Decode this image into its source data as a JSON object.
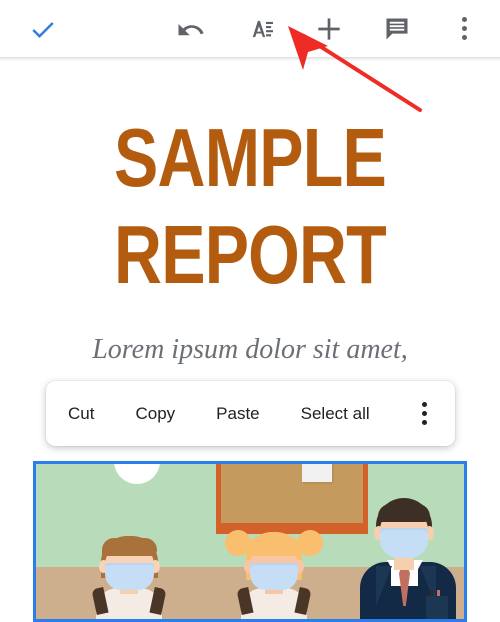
{
  "app": {
    "name": "Google Docs mobile editor",
    "accent_blue": "#2b7de9",
    "icon_gray": "#5f6368",
    "title_color": "#b35c0f",
    "subtitle_color": "#6b7076"
  },
  "toolbar": {
    "accept_label": "✓",
    "accept_name": "accept-checkmark",
    "items": [
      {
        "name": "accept-button",
        "icon": "checkmark-icon",
        "label": "Accept"
      },
      {
        "name": "undo-button",
        "icon": "undo-icon",
        "label": "Undo"
      },
      {
        "name": "format-button",
        "icon": "text-format-icon",
        "label": "Format"
      },
      {
        "name": "insert-button",
        "icon": "plus-icon",
        "label": "Insert"
      },
      {
        "name": "comment-button",
        "icon": "comment-bubble-icon",
        "label": "Comment"
      },
      {
        "name": "overflow-button",
        "icon": "three-dots-vertical-icon",
        "label": "More options"
      }
    ]
  },
  "document": {
    "title": "SAMPLE\nREPORT",
    "subtitle": "Lorem ipsum dolor sit amet,",
    "image": {
      "alt": "Classroom illustration with two masked children and a masked teacher",
      "selected": true,
      "selection_color": "#2b7de9",
      "wall_color": "#b8dcb9",
      "floor_color": "#ceaf8d",
      "board_frame_color": "#d2612a",
      "board_inner_color": "#c49a5f",
      "mask_color": "#c5def5",
      "teacher_jacket_color": "#122a45"
    }
  },
  "context_menu": {
    "items": [
      {
        "name": "context-menu-cut",
        "label": "Cut"
      },
      {
        "name": "context-menu-copy",
        "label": "Copy"
      },
      {
        "name": "context-menu-paste",
        "label": "Paste"
      },
      {
        "name": "context-menu-select-all",
        "label": "Select all"
      }
    ],
    "overflow_name": "context-menu-overflow",
    "overflow_icon": "three-dots-vertical-icon"
  },
  "annotation": {
    "arrow_color": "#ee2b24",
    "points_to": "format-button"
  }
}
